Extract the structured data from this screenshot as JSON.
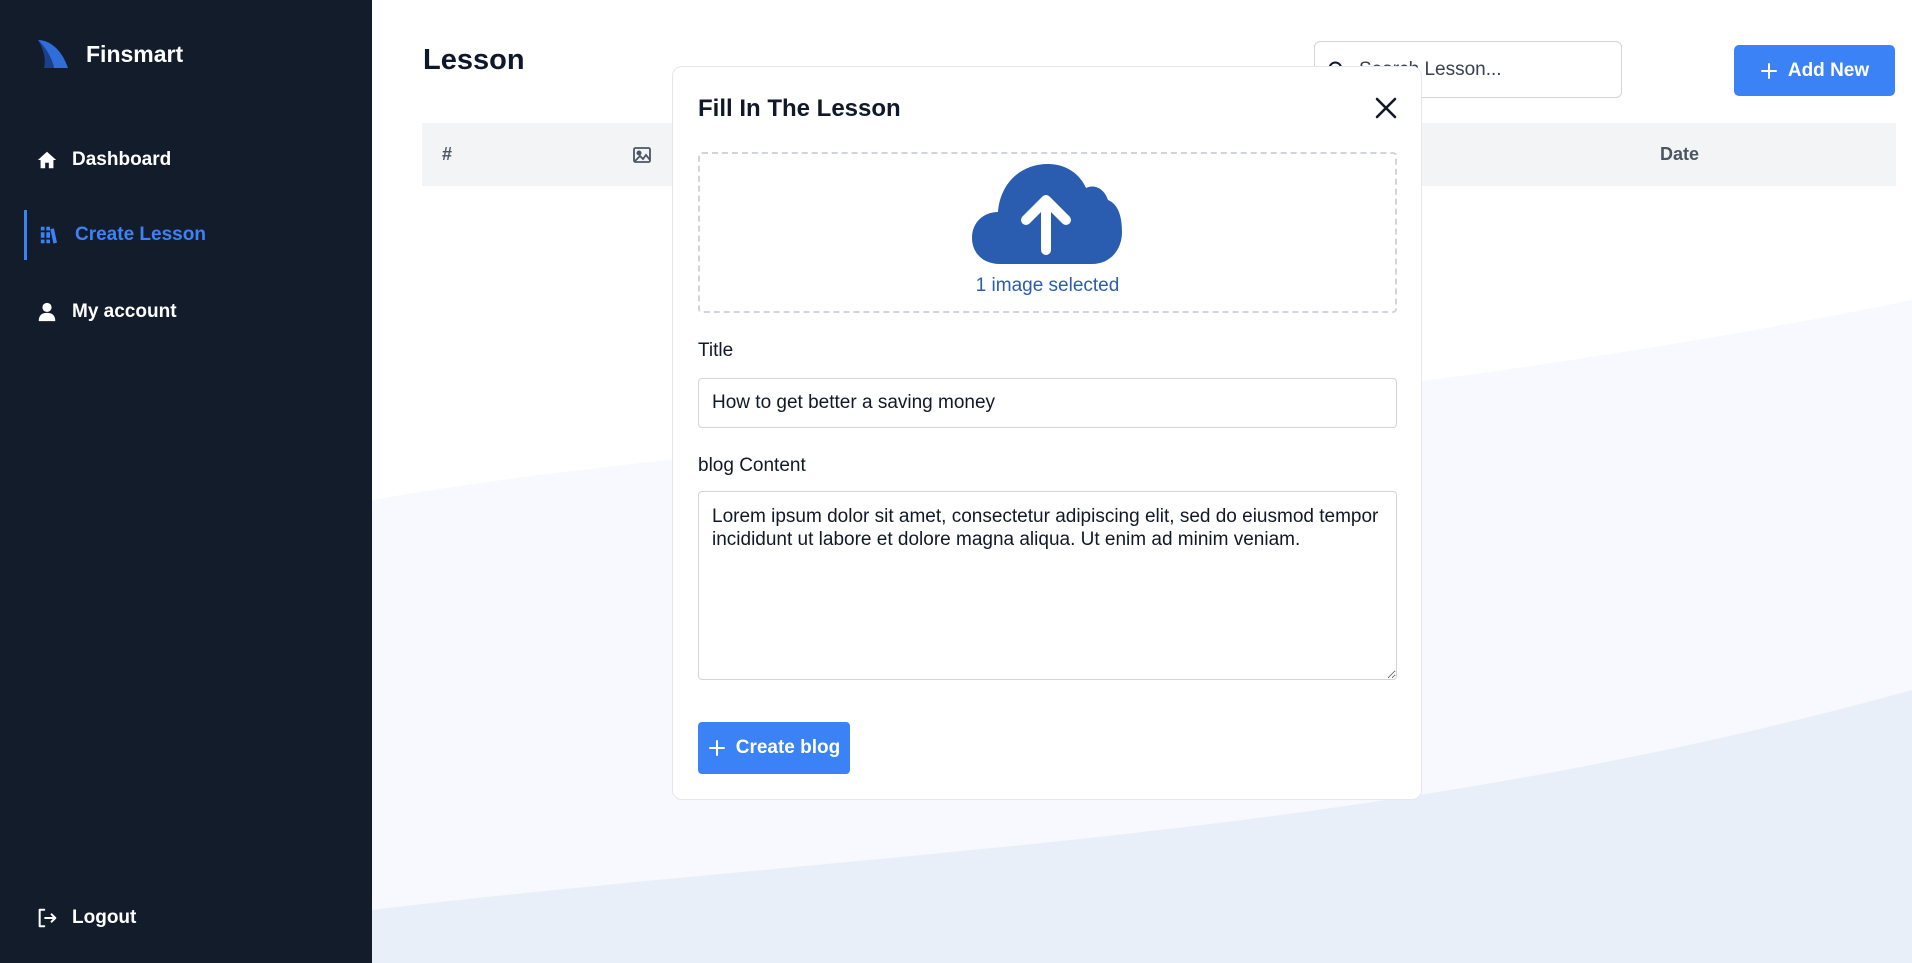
{
  "brand": {
    "name": "Finsmart"
  },
  "sidebar": {
    "items": [
      {
        "label": "Dashboard",
        "icon": "home-icon"
      },
      {
        "label": "Create Lesson",
        "icon": "books-icon",
        "active": true
      },
      {
        "label": "My account",
        "icon": "user-icon"
      }
    ],
    "logout_label": "Logout"
  },
  "page": {
    "title": "Lesson",
    "search_placeholder": "Search Lesson...",
    "add_new_label": "Add New"
  },
  "table": {
    "columns": [
      {
        "label": "#"
      },
      {
        "label": "",
        "icon": "image-icon"
      },
      {
        "label": "Date"
      }
    ]
  },
  "modal": {
    "title": "Fill In The Lesson",
    "dropzone_status": "1 image selected",
    "title_label": "Title",
    "title_value": "How to get better a saving money",
    "content_label": "blog Content",
    "content_value": "Lorem ipsum dolor sit amet, consectetur adipiscing elit, sed do eiusmod tempor incididunt ut labore et dolore magna aliqua. Ut enim ad minim veniam.",
    "submit_label": "Create blog"
  },
  "colors": {
    "sidebar_bg": "#131c2b",
    "accent": "#3b82f6",
    "upload_icon": "#2a5db0"
  }
}
